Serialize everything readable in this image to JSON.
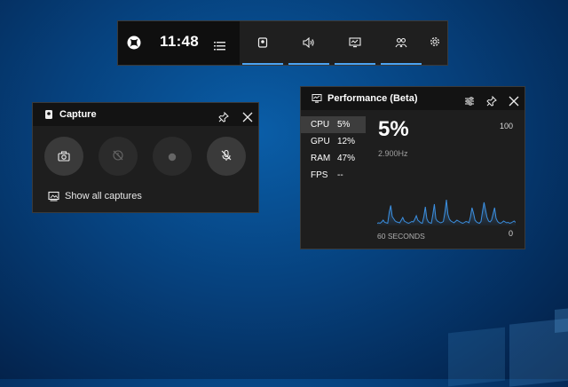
{
  "colors": {
    "accent": "#4aa3f2",
    "graph_line": "#3b8fe0",
    "panel_bg": "#1e1e1e",
    "header_bg": "#131313"
  },
  "topbar": {
    "time": "11:48",
    "icons": [
      "xbox-icon",
      "menu-icon",
      "capture-widget-icon",
      "audio-widget-icon",
      "performance-widget-icon",
      "social-widget-icon",
      "gear-icon"
    ]
  },
  "capture": {
    "title": "Capture",
    "show_all": "Show all captures",
    "buttons": [
      "camera-icon",
      "record-last-icon",
      "record-icon",
      "mic-off-icon"
    ]
  },
  "performance": {
    "title": "Performance (Beta)",
    "metrics": [
      {
        "name": "CPU",
        "value": "5%"
      },
      {
        "name": "GPU",
        "value": "12%"
      },
      {
        "name": "RAM",
        "value": "47%"
      },
      {
        "name": "FPS",
        "value": "--"
      }
    ],
    "big_value": "5%",
    "clock": "2.900Hz",
    "max_label": "100",
    "min_label": "0",
    "duration_label": "60 SECONDS",
    "cpu_history": [
      5,
      6,
      5,
      8,
      12,
      7,
      6,
      5,
      30,
      45,
      20,
      15,
      10,
      8,
      7,
      6,
      12,
      18,
      10,
      8,
      6,
      5,
      7,
      9,
      8,
      14,
      22,
      12,
      9,
      6,
      5,
      20,
      42,
      15,
      8,
      6,
      5,
      25,
      48,
      15,
      10,
      8,
      6,
      7,
      9,
      30,
      58,
      25,
      14,
      10,
      8,
      6,
      9,
      12,
      10,
      8,
      6,
      5,
      7,
      9,
      8,
      6,
      20,
      40,
      28,
      12,
      8,
      6,
      5,
      9,
      32,
      52,
      35,
      18,
      10,
      8,
      12,
      26,
      40,
      16,
      9,
      6,
      5,
      7,
      10,
      8,
      6,
      7,
      5,
      6,
      8,
      10,
      7
    ]
  }
}
